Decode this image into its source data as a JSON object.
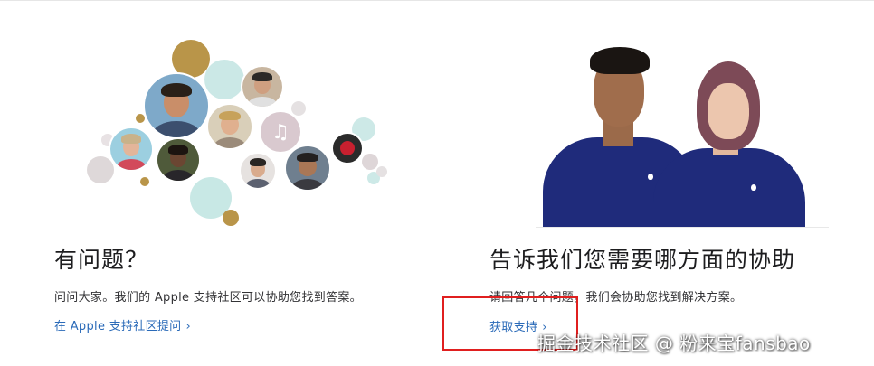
{
  "left_card": {
    "title": "有问题？",
    "description": "问问大家。我们的 Apple 支持社区可以协助您找到答案。",
    "link_label": "在 Apple 支持社区提问",
    "link_chevron": "›",
    "image_icons": [
      "community-photo-bubbles",
      "music-note-icon"
    ]
  },
  "right_card": {
    "title": "告诉我们您需要哪方面的协助",
    "description": "请回答几个问题，我们会协助您找到解决方案。",
    "link_label": "获取支持",
    "link_chevron": "›",
    "image_icons": [
      "apple-staff-photo"
    ]
  },
  "overlay": {
    "highlight_color": "#e01f1f",
    "watermark": "掘金技术社区 @ 粉来宝fansbao"
  },
  "colors": {
    "link": "#2a6ab8",
    "heading": "#1d1d1f",
    "staff_shirt": "#1f2b7b"
  }
}
